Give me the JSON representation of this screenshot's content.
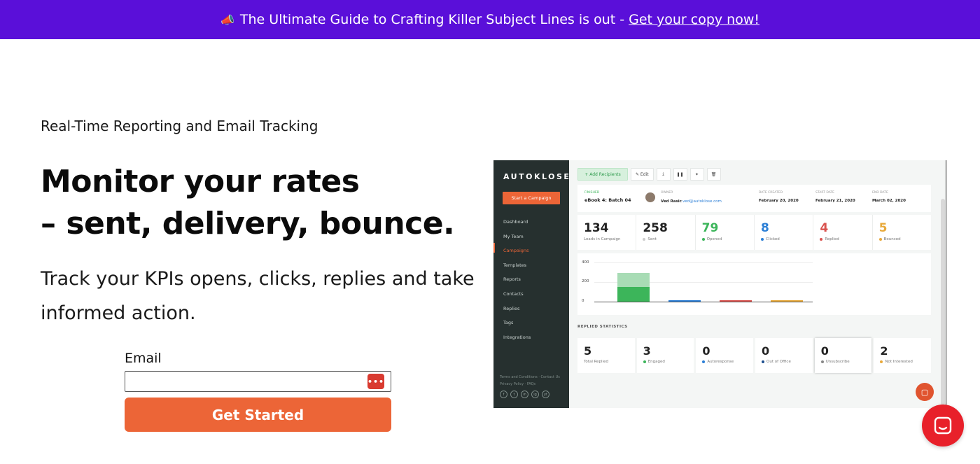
{
  "banner": {
    "icon": "megaphone-icon",
    "text": "The Ultimate Guide to Crafting Killer Subject Lines is out -",
    "link": "Get your copy now!"
  },
  "hero": {
    "eyebrow": "Real-Time Reporting and Email Tracking",
    "headline_line1": "Monitor your rates",
    "headline_line2": "– sent, delivery, bounce.",
    "subhead": "Track your KPIs opens, clicks, replies and take informed action."
  },
  "form": {
    "email_label": "Email",
    "email_value": "",
    "email_placeholder": "",
    "password_manager_icon": "•••",
    "submit_label": "Get Started"
  },
  "dashboard": {
    "logo": "AUTOKLOSE",
    "start_campaign": "Start a Campaign",
    "nav": [
      "Dashboard",
      "My Team",
      "Campaigns",
      "Templates",
      "Reports",
      "Contacts",
      "Replies",
      "Tags",
      "Integrations"
    ],
    "active_nav": "Campaigns",
    "footer_line1": "Terms and Conditions · Contact Us",
    "footer_line2": "Privacy Policy · FAQs",
    "social": [
      "f",
      "t",
      "in",
      "ig",
      "yt"
    ],
    "toolbar": {
      "add_recipients": "+ Add Recipients",
      "edit": "✎ Edit",
      "download": "⤓",
      "pause": "❚❚",
      "pin": "✦",
      "delete": "🗑"
    },
    "campaign": {
      "status_label": "FINISHED",
      "name": "eBook 4: Batch 04",
      "owner_label": "OWNER",
      "owner_name": "Ved Rasic",
      "owner_email": "ved@autoklose.com",
      "date_created_label": "DATE CREATED",
      "date_created": "February 20, 2020",
      "start_date_label": "START DATE",
      "start_date": "February 21, 2020",
      "end_date_label": "END DATE",
      "end_date": "March 02, 2020"
    },
    "stats": [
      {
        "value": "134",
        "label": "Leads in Campaign",
        "color": "#222222",
        "dot": ""
      },
      {
        "value": "258",
        "label": "Sent",
        "color": "#222222",
        "dot": "#cccccc"
      },
      {
        "value": "79",
        "label": "Opened",
        "color": "#3cb55a",
        "dot": "#3cb55a"
      },
      {
        "value": "8",
        "label": "Clicked",
        "color": "#2c7fd6",
        "dot": "#2c7fd6"
      },
      {
        "value": "4",
        "label": "Replied",
        "color": "#d9534f",
        "dot": "#d9534f"
      },
      {
        "value": "5",
        "label": "Bounced",
        "color": "#e8a93a",
        "dot": "#e8a93a"
      }
    ],
    "chart": {
      "y_ticks": [
        "400",
        "200",
        "0"
      ],
      "bars": [
        {
          "total": 290,
          "opened": 150,
          "color_light": "#a8dcb5",
          "color_dark": "#3cb55a"
        },
        {
          "total": 12,
          "opened": 12,
          "color_light": "#2c7fd6",
          "color_dark": "#2c7fd6"
        },
        {
          "total": 8,
          "opened": 8,
          "color_light": "#d9534f",
          "color_dark": "#d9534f"
        },
        {
          "total": 8,
          "opened": 8,
          "color_light": "#e8a93a",
          "color_dark": "#e8a93a"
        }
      ]
    },
    "replied_title": "REPLIED STATISTICS",
    "replied": [
      {
        "value": "5",
        "label": "Total Replied",
        "dot": ""
      },
      {
        "value": "3",
        "label": "Engaged",
        "dot": "#3cb55a"
      },
      {
        "value": "0",
        "label": "Autoresponse",
        "dot": "#2c7fd6"
      },
      {
        "value": "0",
        "label": "Out of Office",
        "dot": "#1d4f8f"
      },
      {
        "value": "0",
        "label": "Unsubscribe",
        "dot": "#888888"
      },
      {
        "value": "2",
        "label": "Not Interested",
        "dot": "#e8a93a"
      }
    ]
  },
  "colors": {
    "banner_bg": "#5a0fd9",
    "cta": "#ec6537",
    "chat": "#e8202a"
  }
}
